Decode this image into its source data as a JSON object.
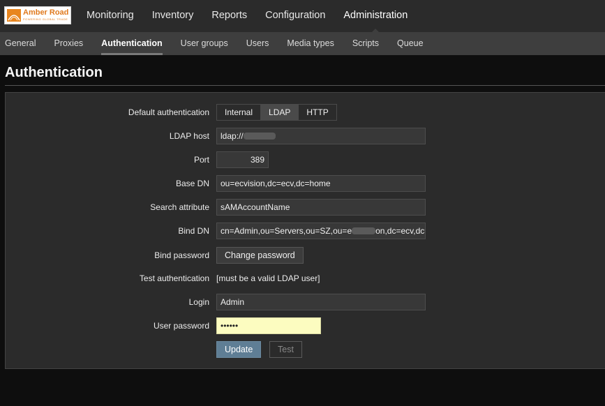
{
  "header": {
    "logo": {
      "text": "Amber Road",
      "tagline": "POWERING GLOBAL TRADE"
    },
    "nav": [
      {
        "label": "Monitoring"
      },
      {
        "label": "Inventory"
      },
      {
        "label": "Reports"
      },
      {
        "label": "Configuration"
      },
      {
        "label": "Administration",
        "active": true
      }
    ]
  },
  "subnav": [
    {
      "label": "General"
    },
    {
      "label": "Proxies"
    },
    {
      "label": "Authentication",
      "active": true
    },
    {
      "label": "User groups"
    },
    {
      "label": "Users"
    },
    {
      "label": "Media types"
    },
    {
      "label": "Scripts"
    },
    {
      "label": "Queue"
    }
  ],
  "page": {
    "title": "Authentication"
  },
  "form": {
    "default_auth": {
      "label": "Default authentication",
      "options": [
        "Internal",
        "LDAP",
        "HTTP"
      ],
      "selected": "LDAP"
    },
    "ldap_host": {
      "label": "LDAP host",
      "value": "ldap://"
    },
    "port": {
      "label": "Port",
      "value": "389"
    },
    "base_dn": {
      "label": "Base DN",
      "value": "ou=ecvision,dc=ecv,dc=home"
    },
    "search_attribute": {
      "label": "Search attribute",
      "value": "sAMAccountName"
    },
    "bind_dn": {
      "label": "Bind DN",
      "value_prefix": "cn=Admin,ou=Servers,ou=SZ,ou=e",
      "value_suffix": "on,dc=ecv,dc="
    },
    "bind_password": {
      "label": "Bind password",
      "button": "Change password"
    },
    "test_auth": {
      "label": "Test authentication",
      "note": "[must be a valid LDAP user]"
    },
    "login": {
      "label": "Login",
      "value": "Admin"
    },
    "user_password": {
      "label": "User password",
      "value": "••••••"
    },
    "buttons": {
      "update": "Update",
      "test": "Test"
    }
  },
  "colors": {
    "accent": "#5f7e95",
    "password_bg": "#fcfcc0",
    "topbar": "#2b2b2b",
    "subbar": "#3e3e3e"
  }
}
